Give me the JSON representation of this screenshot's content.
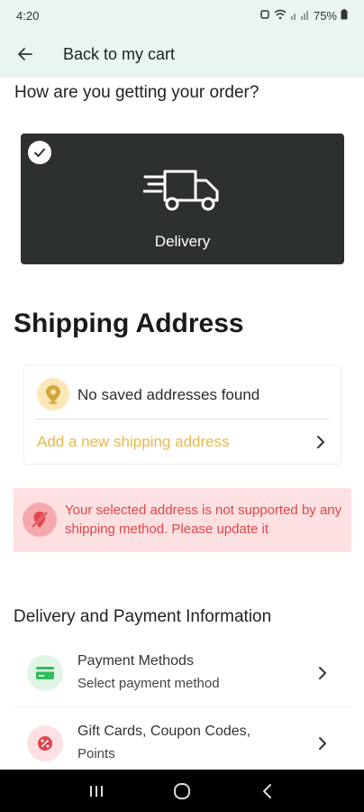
{
  "status_bar": {
    "time": "4:20",
    "battery": "75%"
  },
  "app_bar": {
    "back_label": "Back to my cart"
  },
  "fulfillment": {
    "question": "How are you getting your order?",
    "delivery_label": "Delivery"
  },
  "shipping": {
    "title": "Shipping Address",
    "no_saved": "No saved addresses found",
    "add_new": "Add a new shipping address",
    "error": "Your selected address is not supported by any shipping method. Please update it"
  },
  "delivery_payment": {
    "title": "Delivery and Payment Information",
    "payment_title": "Payment Methods",
    "payment_subtitle": "Select payment method",
    "gift_title": "Gift Cards, Coupon Codes,",
    "gift_subtitle": "Points"
  },
  "colors": {
    "accent": "#e9b84a",
    "error_text": "#e0454c",
    "error_bg": "#fde0e1",
    "header_bg": "#eaf4f3",
    "card_dark": "#2d3030"
  },
  "icons": {
    "back": "arrow-left-icon",
    "check": "check-circle-icon",
    "truck": "delivery-truck-icon",
    "pin": "location-pin-icon",
    "no_location": "location-off-icon",
    "card": "credit-card-icon",
    "coupon": "coupon-percent-icon"
  }
}
